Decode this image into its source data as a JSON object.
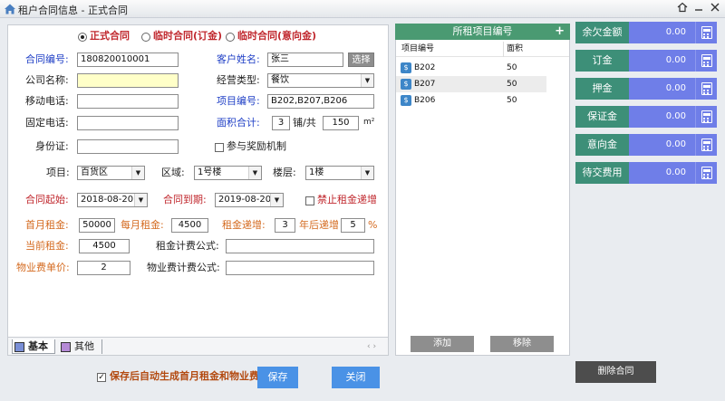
{
  "window": {
    "title": "租户合同信息 - 正式合同"
  },
  "contract_type": {
    "options": [
      "正式合同",
      "临时合同(订金)",
      "临时合同(意向金)"
    ],
    "selected_index": 0
  },
  "form": {
    "contract_no_label": "合同编号:",
    "contract_no": "180820010001",
    "customer_label": "客户姓名:",
    "customer": "张三",
    "select_button": "选择",
    "company_label": "公司名称:",
    "company": "",
    "business_type_label": "经营类型:",
    "business_type": "餐饮",
    "mobile_label": "移动电话:",
    "mobile": "",
    "project_no_label": "项目编号:",
    "project_no": "B202,B207,B206",
    "phone_label": "固定电话:",
    "phone": "",
    "area_total_label": "面积合计:",
    "shop_count": "3",
    "shop_unit": "铺/共",
    "area_total": "150",
    "area_unit": "m²",
    "id_label": "身份证:",
    "id_no": "",
    "reward_label": "参与奖励机制",
    "reward_checked": false,
    "project_label": "项目:",
    "project": "百货区",
    "zone_label": "区域:",
    "zone": "1号楼",
    "floor_label": "楼层:",
    "floor": "1楼",
    "start_label": "合同起始:",
    "start_date": "2018-08-20",
    "end_label": "合同到期:",
    "end_date": "2019-08-20",
    "no_increase_label": "禁止租金递增",
    "no_increase_checked": false,
    "first_rent_label": "首月租金:",
    "first_rent": "50000",
    "monthly_rent_label": "每月租金:",
    "monthly_rent": "4500",
    "increase_label": "租金递增:",
    "increase_years": "3",
    "after_years_label": "年后递增",
    "increase_pct": "5",
    "pct_sign": "%",
    "current_rent_label": "当前租金:",
    "current_rent": "4500",
    "rent_formula_label": "租金计费公式:",
    "rent_formula": "",
    "property_price_label": "物业费单价:",
    "property_price": "2",
    "property_formula_label": "物业费计费公式:",
    "property_formula": ""
  },
  "tabs": [
    {
      "label": "基本"
    },
    {
      "label": "其他"
    }
  ],
  "scroll_hint": "‹ ›",
  "grid": {
    "title": "所租项目编号",
    "add_icon": "+",
    "columns": [
      "项目编号",
      "面积"
    ],
    "rows": [
      {
        "code": "B202",
        "area": "50"
      },
      {
        "code": "B207",
        "area": "50"
      },
      {
        "code": "B206",
        "area": "50"
      }
    ],
    "add_button": "添加",
    "remove_button": "移除"
  },
  "summary": [
    {
      "label": "余欠金额",
      "value": "0.00"
    },
    {
      "label": "订金",
      "value": "0.00"
    },
    {
      "label": "押金",
      "value": "0.00"
    },
    {
      "label": "保证金",
      "value": "0.00"
    },
    {
      "label": "意向金",
      "value": "0.00"
    },
    {
      "label": "待交费用",
      "value": "0.00"
    }
  ],
  "bottom": {
    "auto_gen_label": "保存后自动生成首月租金和物业费",
    "auto_gen_checked": true,
    "save_button": "保存",
    "close_button": "关闭",
    "delete_button": "删除合同"
  },
  "colors": {
    "accent_green": "#4a9a72",
    "card_green": "#3d8f78",
    "card_purple": "#6f7ee8",
    "button_blue": "#4a92e6"
  }
}
